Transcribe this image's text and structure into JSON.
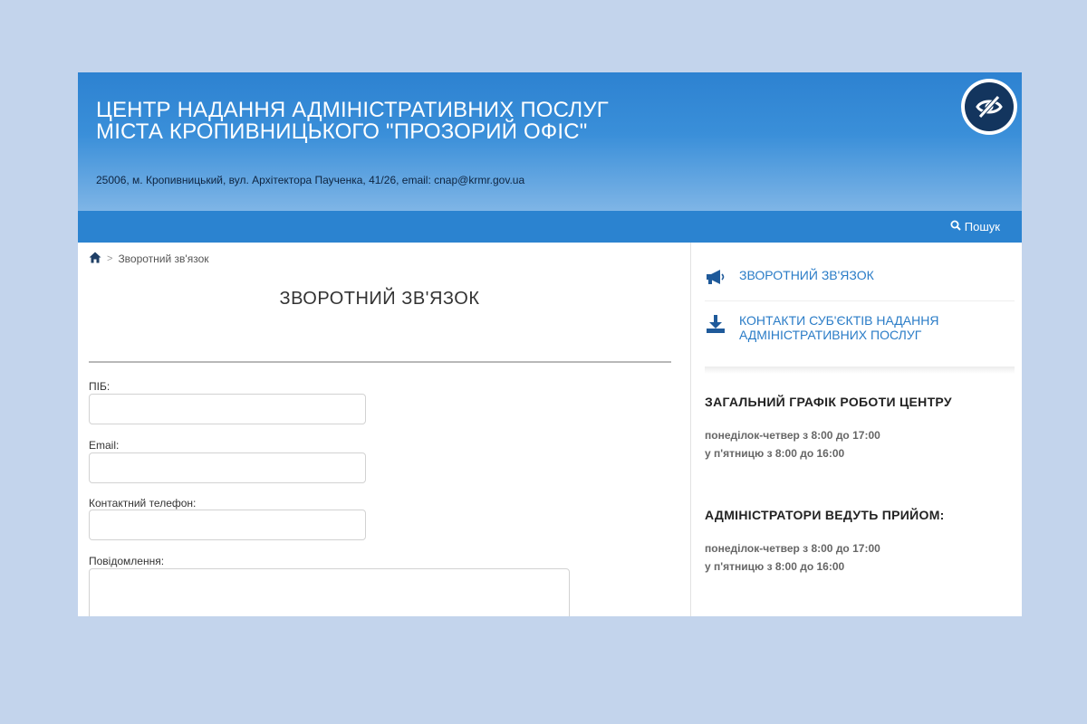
{
  "header": {
    "title_line1": "ЦЕНТР НАДАННЯ АДМІНІСТРАТИВНИХ ПОСЛУГ",
    "title_line2": "МІСТА КРОПИВНИЦЬКОГО \"ПРОЗОРИЙ ОФІС\"",
    "address": "25006, м. Кропивницький, вул. Архітектора Пауче­нка, 41/26, email: cnap@krmr.gov.ua",
    "accessibility_icon": "eye-slash-icon"
  },
  "nav": {
    "search_label": "Пошук",
    "search_icon": "search-icon"
  },
  "breadcrumb": {
    "home_icon": "home-icon",
    "current": "Зворотний зв'язок"
  },
  "main": {
    "title": "ЗВОРОТНИЙ ЗВ'ЯЗОК",
    "form": {
      "name_label": "ПІБ:",
      "email_label": "Email:",
      "phone_label": "Контактний телефон:",
      "message_label": "Повідомлення:"
    }
  },
  "sidebar": {
    "links": [
      {
        "icon": "megaphone-icon",
        "label_line1": "ЗВОРОТНИЙ ЗВ'ЯЗОК",
        "label_line2": ""
      },
      {
        "icon": "download-icon",
        "label_line1": "КОНТАКТИ СУБ'ЄКТІВ НАДАННЯ",
        "label_line2": "АДМІНІСТРАТИВНИХ ПОСЛУГ"
      }
    ],
    "schedule_center": {
      "heading": "ЗАГАЛЬНИЙ ГРАФІК РОБОТИ ЦЕНТРУ",
      "line1": "понеділок-четвер з 8:00 до 17:00",
      "line2": "у п'ятницю з 8:00 до 16:00"
    },
    "schedule_admins": {
      "heading": "АДМІНІСТРАТОРИ ВЕДУТЬ ПРИЙОМ:",
      "line1": "понеділок-четвер з 8:00 до 17:00",
      "line2": "у п'ятницю з 8:00 до 16:00"
    }
  },
  "colors": {
    "page_background": "#c3d4ec",
    "header_blue": "#2d82d1",
    "navbar_blue": "#2b83d0",
    "link_blue": "#2a7cc7",
    "eye_button_dark": "#13355e"
  }
}
